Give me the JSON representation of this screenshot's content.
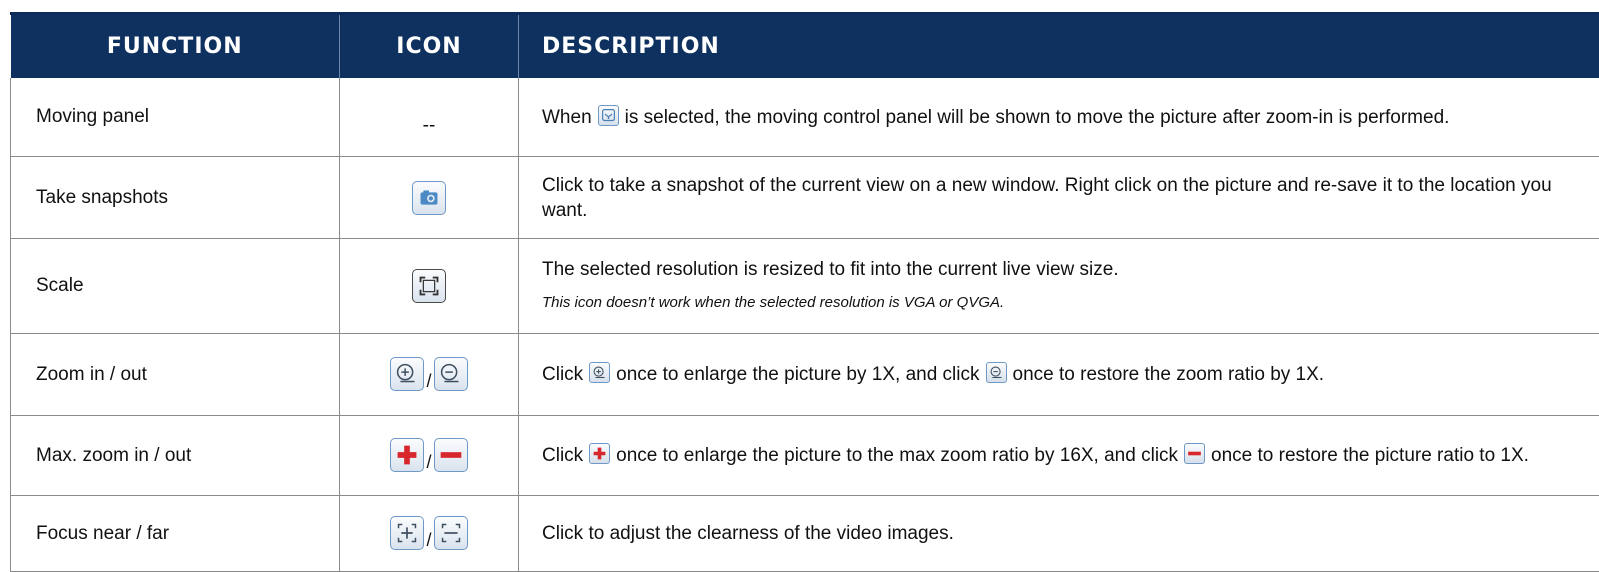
{
  "header": {
    "function": "FUNCTION",
    "icon": "ICON",
    "description": "DESCRIPTION"
  },
  "rows": [
    {
      "function": "Moving panel",
      "icon_text": "--",
      "desc_before": "When",
      "desc_icon": "moving-panel-icon",
      "desc_after": "is selected, the moving control panel will be shown to move the picture after zoom-in is performed."
    },
    {
      "function": "Take snapshots",
      "icon": "camera-icon",
      "description": "Click to take a snapshot of the current view on a new window. Right click on the picture and re-save it to the location you want."
    },
    {
      "function": "Scale",
      "icon": "scale-icon",
      "description": "The selected resolution is resized to fit into the current live view size.",
      "note": "This icon doesn’t work when the selected resolution is VGA or QVGA."
    },
    {
      "function": "Zoom in / out",
      "icons": [
        "zoom-in-icon",
        "zoom-out-icon"
      ],
      "separator": "/",
      "desc_parts": [
        "Click",
        "once to enlarge the picture by 1X, and click",
        "once to restore the zoom ratio by 1X."
      ]
    },
    {
      "function": "Max. zoom in / out",
      "icons": [
        "max-zoom-in-icon",
        "max-zoom-out-icon"
      ],
      "separator": "/",
      "desc_parts": [
        "Click",
        "once to enlarge the picture to the max zoom ratio by 16X, and click",
        "once to restore the picture ratio to 1X."
      ]
    },
    {
      "function": "Focus near / far",
      "icons": [
        "focus-near-icon",
        "focus-far-icon"
      ],
      "separator": "/",
      "description": "Click to adjust the clearness of the video images."
    }
  ],
  "colors": {
    "header_bg": "#0e3160",
    "header_text": "#ffffff",
    "icon_border": "#6e99c6",
    "max_zoom_red": "#d8262d"
  }
}
